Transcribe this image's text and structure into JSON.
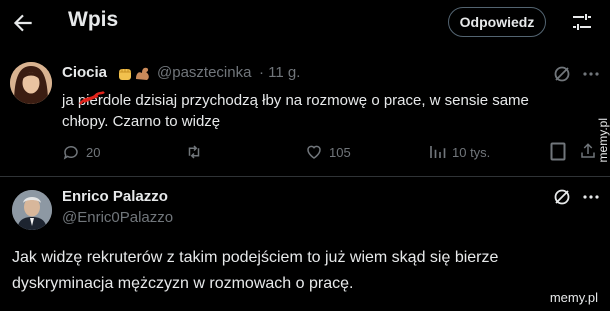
{
  "header": {
    "title": "Wpis",
    "reply_label": "Odpowiedz"
  },
  "tweet1": {
    "name": "Ciocia",
    "emoji_icons": [
      "raised-fist-icon",
      "flexed-biceps-icon"
    ],
    "handle": "@pasztecinka",
    "time": "· 11 g.",
    "text_line1": "ja pierdole dzisiaj przychodzą łby na rozmowę o prace, w sensie same",
    "text_line2": "chłopy. Czarno to widzę",
    "stats": {
      "replies": "20",
      "likes": "105",
      "views": "10 tys."
    }
  },
  "tweet2": {
    "name": "Enrico Palazzo",
    "handle": "@Enric0Palazzo",
    "text_line1": "Jak widzę rekruterów z takim podejściem to już wiem skąd się bierze",
    "text_line2": "dyskryminacja mężczyzn w rozmowach o pracę."
  },
  "watermark": {
    "side": "memy.pl",
    "bottom": "memy.pl"
  },
  "colors": {
    "background": "#000000",
    "text": "#e7e9ea",
    "muted": "#71767b",
    "divider": "#2f3336"
  }
}
